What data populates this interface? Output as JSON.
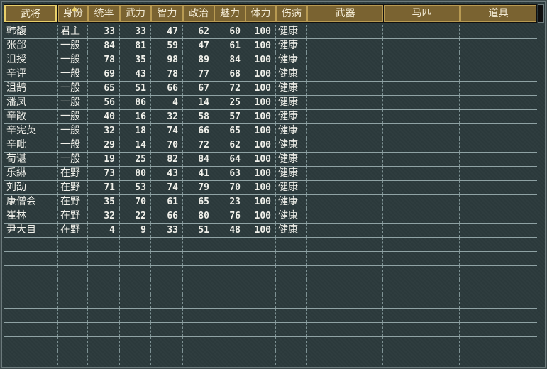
{
  "columns": [
    "武将",
    "身份",
    "统率",
    "武力",
    "智力",
    "政治",
    "魅力",
    "体力",
    "伤病",
    "武器",
    "马匹",
    "道具"
  ],
  "sorted_column": "身份",
  "rows": [
    [
      "韩馥",
      "君主",
      "33",
      "33",
      "47",
      "62",
      "60",
      "100",
      "健康",
      "",
      "",
      ""
    ],
    [
      "张郃",
      "一般",
      "84",
      "81",
      "59",
      "47",
      "61",
      "100",
      "健康",
      "",
      "",
      ""
    ],
    [
      "沮授",
      "一般",
      "78",
      "35",
      "98",
      "89",
      "84",
      "100",
      "健康",
      "",
      "",
      ""
    ],
    [
      "辛评",
      "一般",
      "69",
      "43",
      "78",
      "77",
      "68",
      "100",
      "健康",
      "",
      "",
      ""
    ],
    [
      "沮鹄",
      "一般",
      "65",
      "51",
      "66",
      "67",
      "72",
      "100",
      "健康",
      "",
      "",
      ""
    ],
    [
      "潘凤",
      "一般",
      "56",
      "86",
      "4",
      "14",
      "25",
      "100",
      "健康",
      "",
      "",
      ""
    ],
    [
      "辛敞",
      "一般",
      "40",
      "16",
      "32",
      "58",
      "57",
      "100",
      "健康",
      "",
      "",
      ""
    ],
    [
      "辛宪英",
      "一般",
      "32",
      "18",
      "74",
      "66",
      "65",
      "100",
      "健康",
      "",
      "",
      ""
    ],
    [
      "辛毗",
      "一般",
      "29",
      "14",
      "70",
      "72",
      "62",
      "100",
      "健康",
      "",
      "",
      ""
    ],
    [
      "荀谌",
      "一般",
      "19",
      "25",
      "82",
      "84",
      "64",
      "100",
      "健康",
      "",
      "",
      ""
    ],
    [
      "乐綝",
      "在野",
      "73",
      "80",
      "43",
      "41",
      "63",
      "100",
      "健康",
      "",
      "",
      ""
    ],
    [
      "刘劭",
      "在野",
      "71",
      "53",
      "74",
      "79",
      "70",
      "100",
      "健康",
      "",
      "",
      ""
    ],
    [
      "康僧会",
      "在野",
      "35",
      "70",
      "61",
      "65",
      "23",
      "100",
      "健康",
      "",
      "",
      ""
    ],
    [
      "崔林",
      "在野",
      "32",
      "22",
      "66",
      "80",
      "76",
      "100",
      "健康",
      "",
      "",
      ""
    ],
    [
      "尹大目",
      "在野",
      "4",
      "9",
      "33",
      "51",
      "48",
      "100",
      "健康",
      "",
      "",
      ""
    ]
  ]
}
